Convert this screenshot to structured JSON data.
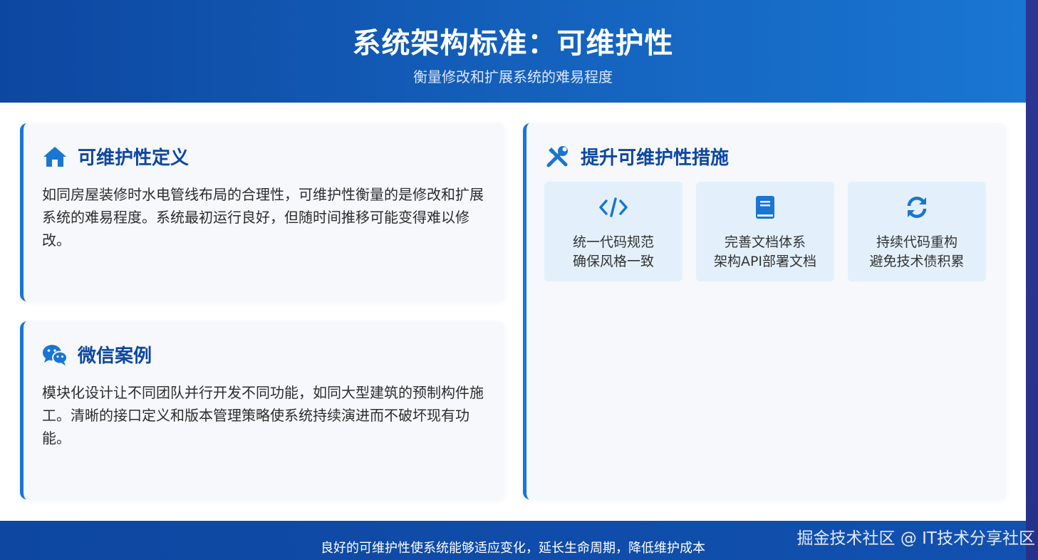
{
  "header": {
    "title": "系统架构标准：可维护性",
    "subtitle": "衡量修改和扩展系统的难易程度"
  },
  "definition_card": {
    "icon": "home-icon",
    "title": "可维护性定义",
    "body": "如同房屋装修时水电管线布局的合理性，可维护性衡量的是修改和扩展系统的难易程度。系统最初运行良好，但随时间推移可能变得难以修改。"
  },
  "wechat_card": {
    "icon": "wechat-icon",
    "title": "微信案例",
    "body": "模块化设计让不同团队并行开发不同功能，如同大型建筑的预制构件施工。清晰的接口定义和版本管理策略使系统持续演进而不破坏现有功能。"
  },
  "measures_card": {
    "icon": "tools-icon",
    "title": "提升可维护性措施",
    "items": [
      {
        "icon": "code-icon",
        "line1": "统一代码规范",
        "line2": "确保风格一致"
      },
      {
        "icon": "book-icon",
        "line1": "完善文档体系",
        "line2": "架构API部署文档"
      },
      {
        "icon": "sync-icon",
        "line1": "持续代码重构",
        "line2": "避免技术债积累"
      }
    ]
  },
  "footer": {
    "text": "良好的可维护性使系统能够适应变化，延长生命周期，降低维护成本"
  },
  "watermark": "掘金技术社区 @ IT技术分享社区",
  "colors": {
    "primary": "#0d47a1",
    "accent": "#1976d2",
    "card_bg": "#f6f8fb",
    "tile_bg": "#e3f0fc"
  }
}
